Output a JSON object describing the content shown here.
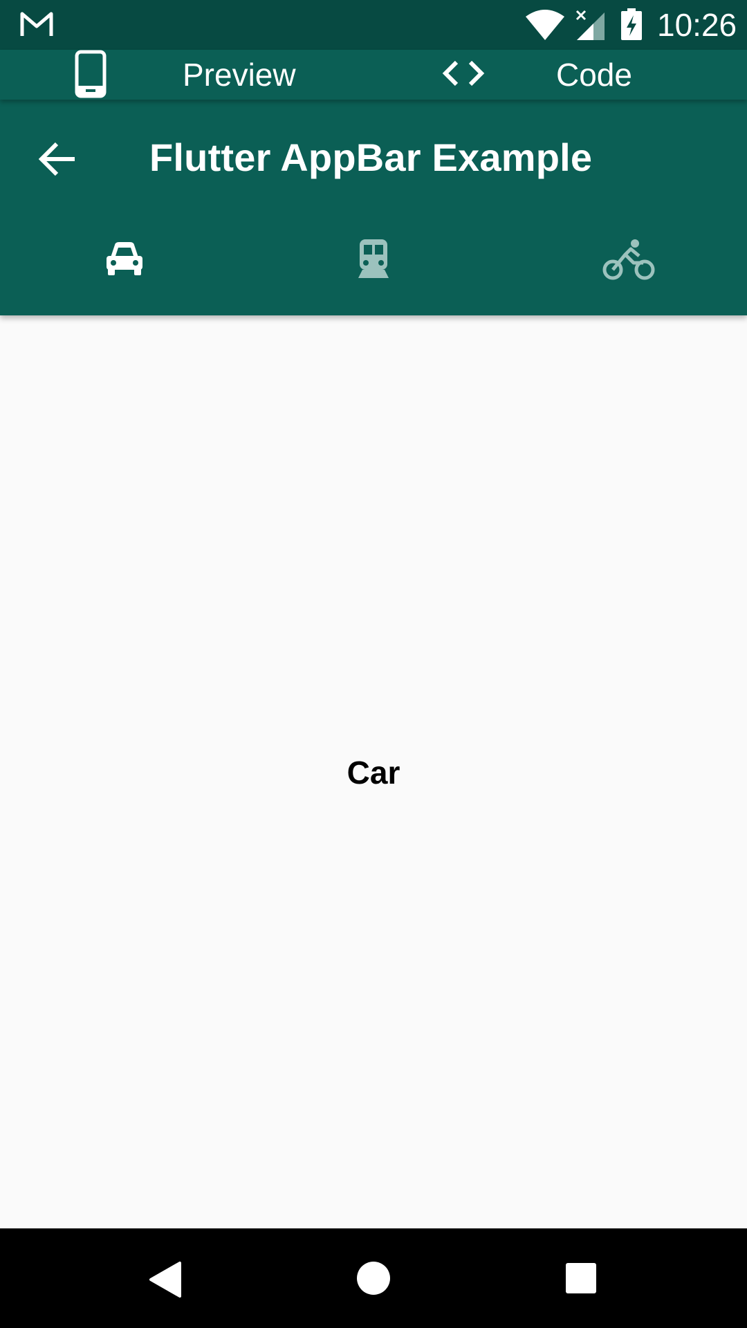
{
  "status_bar": {
    "time": "10:26",
    "icons": [
      "gmail-icon",
      "wifi-icon",
      "signal-icon",
      "battery-charging-icon"
    ]
  },
  "preview_bar": {
    "preview_label": "Preview",
    "code_label": "Code",
    "icons": [
      "phone-icon",
      "code-icon"
    ]
  },
  "app_bar": {
    "title": "Flutter AppBar Example",
    "back_icon": "arrow-back-icon"
  },
  "tabs": [
    {
      "icon": "car-icon",
      "selected": true
    },
    {
      "icon": "train-icon",
      "selected": false
    },
    {
      "icon": "bike-icon",
      "selected": false
    }
  ],
  "content": {
    "text": "Car"
  },
  "nav_bar": {
    "icons": [
      "nav-back-icon",
      "nav-home-icon",
      "nav-recents-icon"
    ]
  },
  "colors": {
    "status_bar": "#074A42",
    "app_bar": "#0B5F55",
    "background": "#FAFAFA",
    "selected_tab": "#FFFFFF",
    "unselected_tab": "#9CC2BD"
  }
}
